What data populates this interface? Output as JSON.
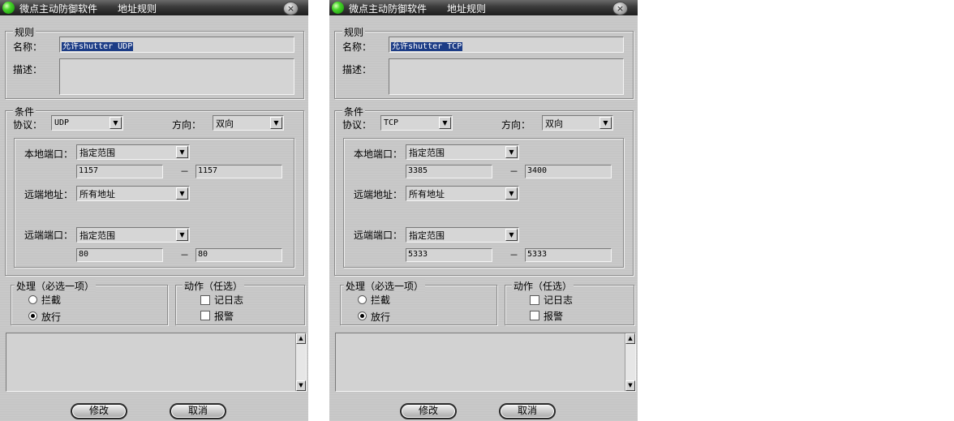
{
  "dialogs": [
    {
      "app_title": "微点主动防御软件",
      "window_title": "地址规则",
      "close_icon": "×",
      "rule_group": "规则",
      "name_label": "名称：",
      "name_value": "允许shutter UDP",
      "desc_label": "描述：",
      "cond_group": "条件",
      "protocol_label": "协议：",
      "protocol_value": "UDP",
      "direction_label": "方向：",
      "direction_value": "双向",
      "local_port_label": "本地端口：",
      "local_port_mode": "指定范围",
      "local_port_from": "1157",
      "local_port_to": "1157",
      "remote_addr_label": "远端地址：",
      "remote_addr_mode": "所有地址",
      "remote_port_label": "远端端口：",
      "remote_port_mode": "指定范围",
      "remote_port_from": "80",
      "remote_port_to": "80",
      "dash": "－",
      "handle_group": "处理（必选一项）",
      "block_label": "拦截",
      "allow_label": "放行",
      "action_group": "动作（任选）",
      "log_label": "记日志",
      "alarm_label": "报警",
      "modify_button": "修改",
      "cancel_button": "取消",
      "arrow_glyph": "▼",
      "scroll_up": "▲",
      "scroll_down": "▼"
    },
    {
      "app_title": "微点主动防御软件",
      "window_title": "地址规则",
      "close_icon": "×",
      "rule_group": "规则",
      "name_label": "名称：",
      "name_value": "允许shutter TCP",
      "desc_label": "描述：",
      "cond_group": "条件",
      "protocol_label": "协议：",
      "protocol_value": "TCP",
      "direction_label": "方向：",
      "direction_value": "双向",
      "local_port_label": "本地端口：",
      "local_port_mode": "指定范围",
      "local_port_from": "3385",
      "local_port_to": "3400",
      "remote_addr_label": "远端地址：",
      "remote_addr_mode": "所有地址",
      "remote_port_label": "远端端口：",
      "remote_port_mode": "指定范围",
      "remote_port_from": "5333",
      "remote_port_to": "5333",
      "dash": "－",
      "handle_group": "处理（必选一项）",
      "block_label": "拦截",
      "allow_label": "放行",
      "action_group": "动作（任选）",
      "log_label": "记日志",
      "alarm_label": "报警",
      "modify_button": "修改",
      "cancel_button": "取消",
      "arrow_glyph": "▼",
      "scroll_up": "▲",
      "scroll_down": "▼"
    }
  ],
  "state": {
    "selected_handle": "allow",
    "log_checked": false,
    "alarm_checked": false
  }
}
